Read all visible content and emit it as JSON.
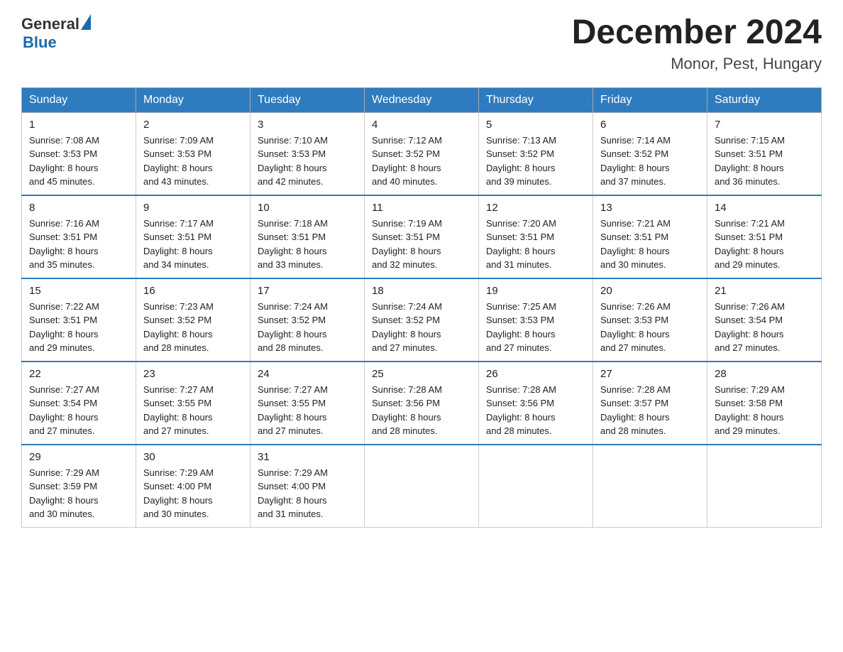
{
  "logo": {
    "general": "General",
    "blue": "Blue"
  },
  "title": "December 2024",
  "subtitle": "Monor, Pest, Hungary",
  "days_of_week": [
    "Sunday",
    "Monday",
    "Tuesday",
    "Wednesday",
    "Thursday",
    "Friday",
    "Saturday"
  ],
  "weeks": [
    [
      {
        "day": "1",
        "sunrise": "Sunrise: 7:08 AM",
        "sunset": "Sunset: 3:53 PM",
        "daylight": "Daylight: 8 hours",
        "daylight2": "and 45 minutes."
      },
      {
        "day": "2",
        "sunrise": "Sunrise: 7:09 AM",
        "sunset": "Sunset: 3:53 PM",
        "daylight": "Daylight: 8 hours",
        "daylight2": "and 43 minutes."
      },
      {
        "day": "3",
        "sunrise": "Sunrise: 7:10 AM",
        "sunset": "Sunset: 3:53 PM",
        "daylight": "Daylight: 8 hours",
        "daylight2": "and 42 minutes."
      },
      {
        "day": "4",
        "sunrise": "Sunrise: 7:12 AM",
        "sunset": "Sunset: 3:52 PM",
        "daylight": "Daylight: 8 hours",
        "daylight2": "and 40 minutes."
      },
      {
        "day": "5",
        "sunrise": "Sunrise: 7:13 AM",
        "sunset": "Sunset: 3:52 PM",
        "daylight": "Daylight: 8 hours",
        "daylight2": "and 39 minutes."
      },
      {
        "day": "6",
        "sunrise": "Sunrise: 7:14 AM",
        "sunset": "Sunset: 3:52 PM",
        "daylight": "Daylight: 8 hours",
        "daylight2": "and 37 minutes."
      },
      {
        "day": "7",
        "sunrise": "Sunrise: 7:15 AM",
        "sunset": "Sunset: 3:51 PM",
        "daylight": "Daylight: 8 hours",
        "daylight2": "and 36 minutes."
      }
    ],
    [
      {
        "day": "8",
        "sunrise": "Sunrise: 7:16 AM",
        "sunset": "Sunset: 3:51 PM",
        "daylight": "Daylight: 8 hours",
        "daylight2": "and 35 minutes."
      },
      {
        "day": "9",
        "sunrise": "Sunrise: 7:17 AM",
        "sunset": "Sunset: 3:51 PM",
        "daylight": "Daylight: 8 hours",
        "daylight2": "and 34 minutes."
      },
      {
        "day": "10",
        "sunrise": "Sunrise: 7:18 AM",
        "sunset": "Sunset: 3:51 PM",
        "daylight": "Daylight: 8 hours",
        "daylight2": "and 33 minutes."
      },
      {
        "day": "11",
        "sunrise": "Sunrise: 7:19 AM",
        "sunset": "Sunset: 3:51 PM",
        "daylight": "Daylight: 8 hours",
        "daylight2": "and 32 minutes."
      },
      {
        "day": "12",
        "sunrise": "Sunrise: 7:20 AM",
        "sunset": "Sunset: 3:51 PM",
        "daylight": "Daylight: 8 hours",
        "daylight2": "and 31 minutes."
      },
      {
        "day": "13",
        "sunrise": "Sunrise: 7:21 AM",
        "sunset": "Sunset: 3:51 PM",
        "daylight": "Daylight: 8 hours",
        "daylight2": "and 30 minutes."
      },
      {
        "day": "14",
        "sunrise": "Sunrise: 7:21 AM",
        "sunset": "Sunset: 3:51 PM",
        "daylight": "Daylight: 8 hours",
        "daylight2": "and 29 minutes."
      }
    ],
    [
      {
        "day": "15",
        "sunrise": "Sunrise: 7:22 AM",
        "sunset": "Sunset: 3:51 PM",
        "daylight": "Daylight: 8 hours",
        "daylight2": "and 29 minutes."
      },
      {
        "day": "16",
        "sunrise": "Sunrise: 7:23 AM",
        "sunset": "Sunset: 3:52 PM",
        "daylight": "Daylight: 8 hours",
        "daylight2": "and 28 minutes."
      },
      {
        "day": "17",
        "sunrise": "Sunrise: 7:24 AM",
        "sunset": "Sunset: 3:52 PM",
        "daylight": "Daylight: 8 hours",
        "daylight2": "and 28 minutes."
      },
      {
        "day": "18",
        "sunrise": "Sunrise: 7:24 AM",
        "sunset": "Sunset: 3:52 PM",
        "daylight": "Daylight: 8 hours",
        "daylight2": "and 27 minutes."
      },
      {
        "day": "19",
        "sunrise": "Sunrise: 7:25 AM",
        "sunset": "Sunset: 3:53 PM",
        "daylight": "Daylight: 8 hours",
        "daylight2": "and 27 minutes."
      },
      {
        "day": "20",
        "sunrise": "Sunrise: 7:26 AM",
        "sunset": "Sunset: 3:53 PM",
        "daylight": "Daylight: 8 hours",
        "daylight2": "and 27 minutes."
      },
      {
        "day": "21",
        "sunrise": "Sunrise: 7:26 AM",
        "sunset": "Sunset: 3:54 PM",
        "daylight": "Daylight: 8 hours",
        "daylight2": "and 27 minutes."
      }
    ],
    [
      {
        "day": "22",
        "sunrise": "Sunrise: 7:27 AM",
        "sunset": "Sunset: 3:54 PM",
        "daylight": "Daylight: 8 hours",
        "daylight2": "and 27 minutes."
      },
      {
        "day": "23",
        "sunrise": "Sunrise: 7:27 AM",
        "sunset": "Sunset: 3:55 PM",
        "daylight": "Daylight: 8 hours",
        "daylight2": "and 27 minutes."
      },
      {
        "day": "24",
        "sunrise": "Sunrise: 7:27 AM",
        "sunset": "Sunset: 3:55 PM",
        "daylight": "Daylight: 8 hours",
        "daylight2": "and 27 minutes."
      },
      {
        "day": "25",
        "sunrise": "Sunrise: 7:28 AM",
        "sunset": "Sunset: 3:56 PM",
        "daylight": "Daylight: 8 hours",
        "daylight2": "and 28 minutes."
      },
      {
        "day": "26",
        "sunrise": "Sunrise: 7:28 AM",
        "sunset": "Sunset: 3:56 PM",
        "daylight": "Daylight: 8 hours",
        "daylight2": "and 28 minutes."
      },
      {
        "day": "27",
        "sunrise": "Sunrise: 7:28 AM",
        "sunset": "Sunset: 3:57 PM",
        "daylight": "Daylight: 8 hours",
        "daylight2": "and 28 minutes."
      },
      {
        "day": "28",
        "sunrise": "Sunrise: 7:29 AM",
        "sunset": "Sunset: 3:58 PM",
        "daylight": "Daylight: 8 hours",
        "daylight2": "and 29 minutes."
      }
    ],
    [
      {
        "day": "29",
        "sunrise": "Sunrise: 7:29 AM",
        "sunset": "Sunset: 3:59 PM",
        "daylight": "Daylight: 8 hours",
        "daylight2": "and 30 minutes."
      },
      {
        "day": "30",
        "sunrise": "Sunrise: 7:29 AM",
        "sunset": "Sunset: 4:00 PM",
        "daylight": "Daylight: 8 hours",
        "daylight2": "and 30 minutes."
      },
      {
        "day": "31",
        "sunrise": "Sunrise: 7:29 AM",
        "sunset": "Sunset: 4:00 PM",
        "daylight": "Daylight: 8 hours",
        "daylight2": "and 31 minutes."
      },
      null,
      null,
      null,
      null
    ]
  ]
}
